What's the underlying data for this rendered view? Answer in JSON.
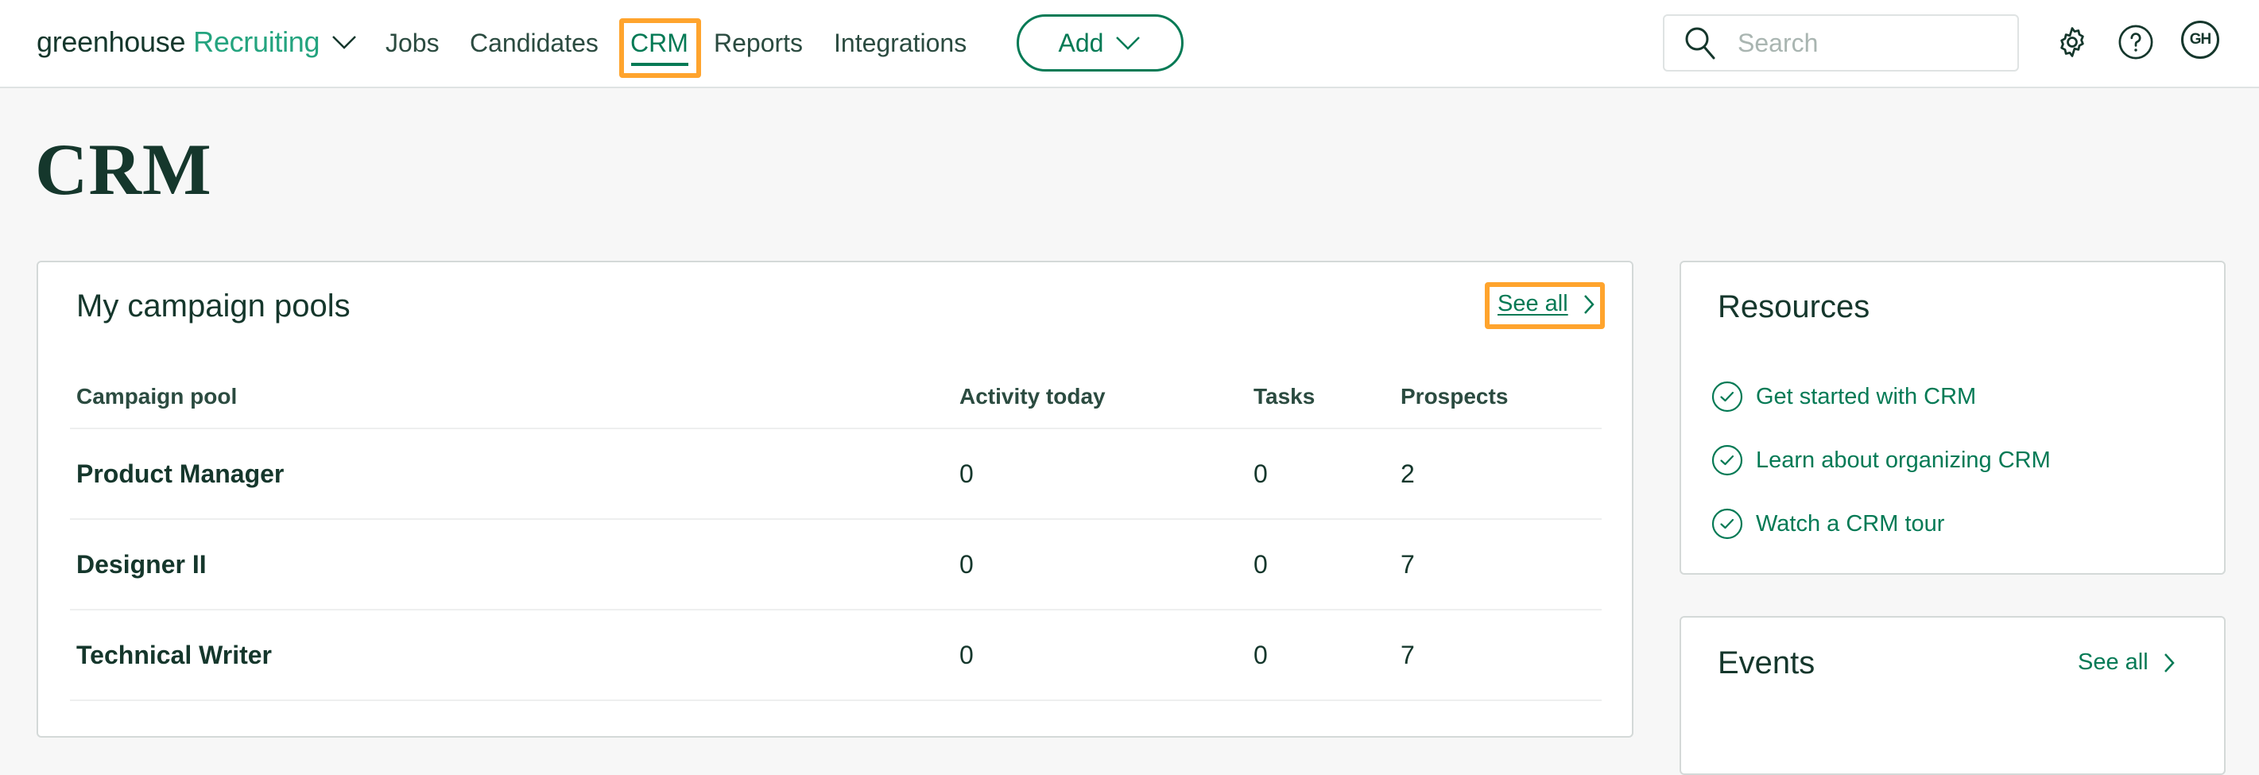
{
  "header": {
    "brand_primary": "greenhouse",
    "brand_product": "Recruiting",
    "nav": [
      {
        "label": "Jobs",
        "active": false
      },
      {
        "label": "Candidates",
        "active": false
      },
      {
        "label": "CRM",
        "active": true
      },
      {
        "label": "Reports",
        "active": false
      },
      {
        "label": "Integrations",
        "active": false
      }
    ],
    "add_label": "Add",
    "search": {
      "placeholder": "Search",
      "value": ""
    },
    "icons": [
      "search-icon",
      "gear-icon",
      "help-icon"
    ],
    "avatar_initials": "GH"
  },
  "page": {
    "title": "CRM"
  },
  "campaign_pools": {
    "title": "My campaign pools",
    "see_all": "See all",
    "columns": [
      "Campaign pool",
      "Activity today",
      "Tasks",
      "Prospects"
    ],
    "rows": [
      {
        "name": "Product Manager",
        "activity_today": "0",
        "tasks": "0",
        "prospects": "2"
      },
      {
        "name": "Designer II",
        "activity_today": "0",
        "tasks": "0",
        "prospects": "7"
      },
      {
        "name": "Technical Writer",
        "activity_today": "0",
        "tasks": "0",
        "prospects": "7"
      }
    ]
  },
  "resources": {
    "title": "Resources",
    "items": [
      {
        "label": "Get started with CRM",
        "icon": "check-circle-icon"
      },
      {
        "label": "Learn about organizing CRM",
        "icon": "check-circle-icon"
      },
      {
        "label": "Watch a CRM tour",
        "icon": "check-circle-icon"
      }
    ]
  },
  "events": {
    "title": "Events",
    "see_all": "See all"
  },
  "colors": {
    "brand_green": "#047a55",
    "brand_light_green": "#24a47f",
    "text_dark": "#15372c",
    "highlight": "#ffa42d",
    "page_bg": "#f7f7f7"
  }
}
